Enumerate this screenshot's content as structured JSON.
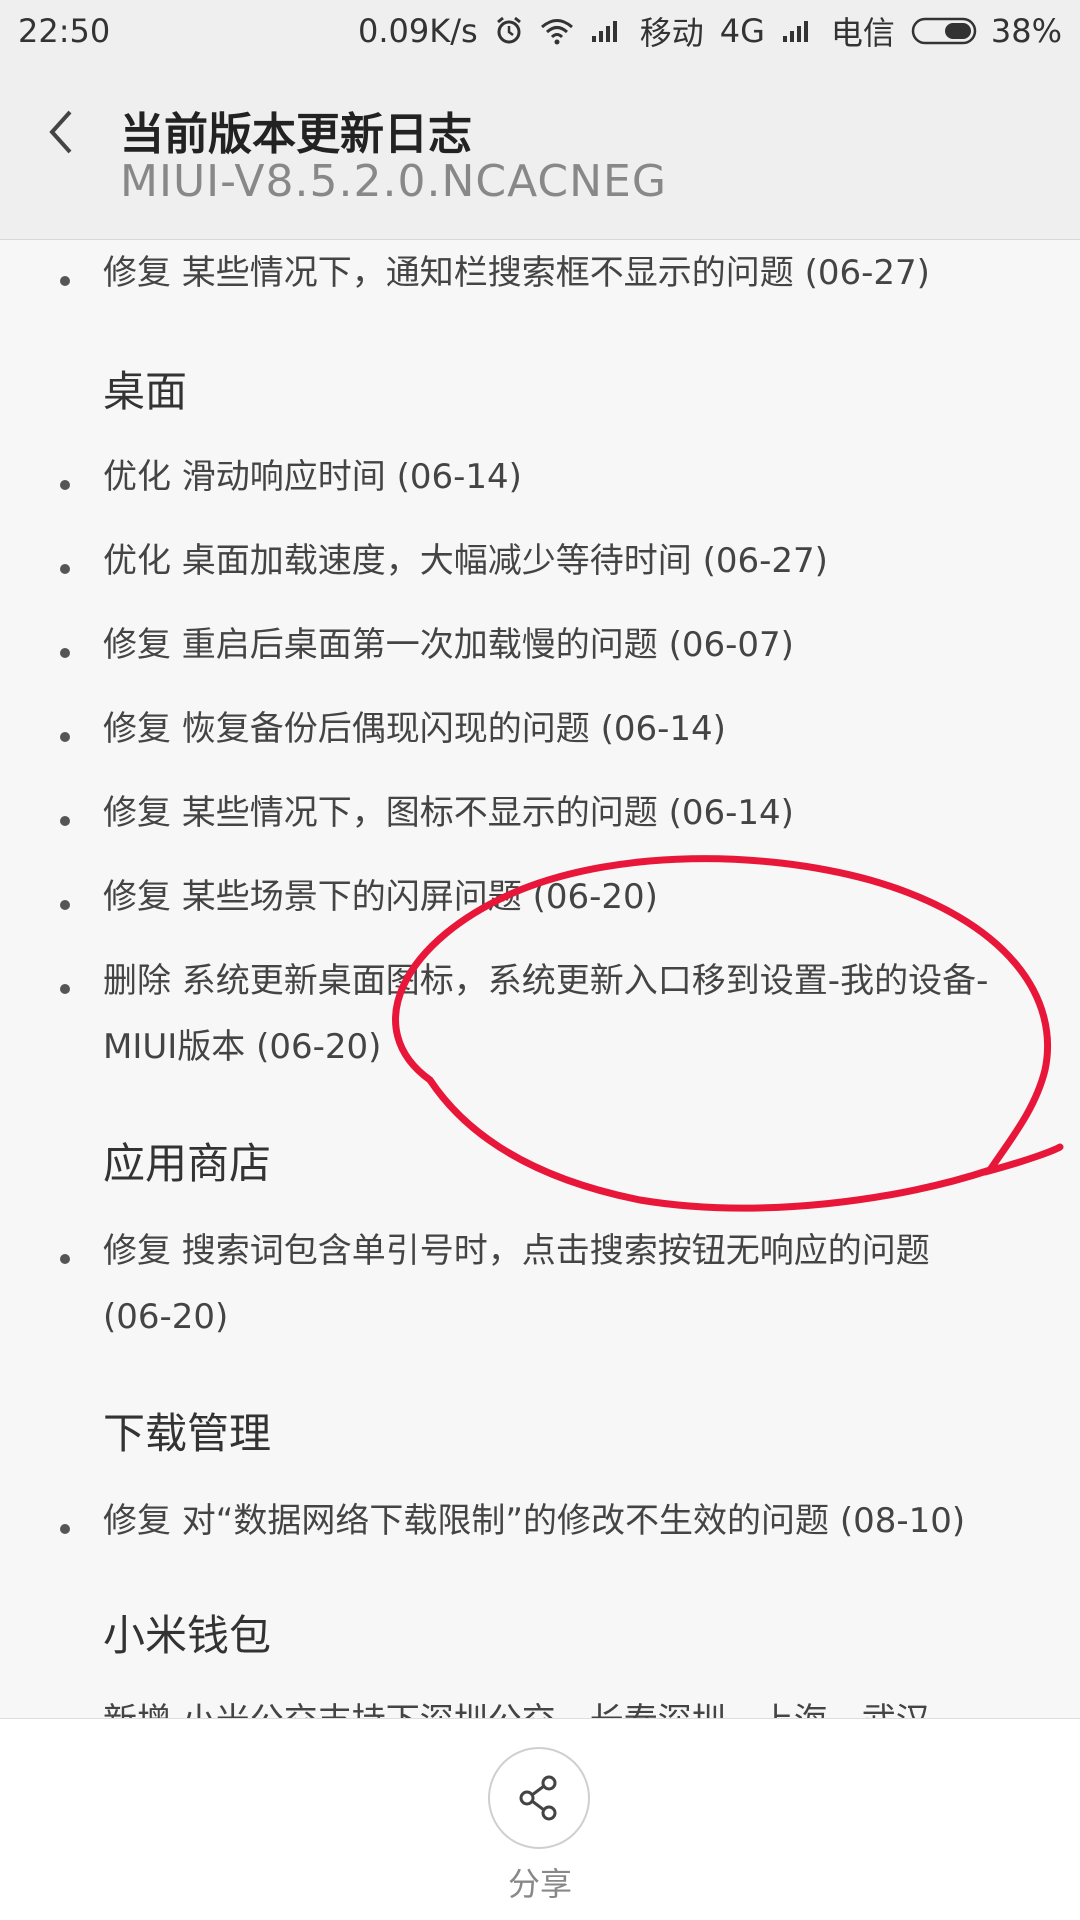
{
  "status_bar": {
    "time": "22:50",
    "net_speed": "0.09K/s",
    "carrier1": "移动",
    "network_type": "4G",
    "carrier2": "电信",
    "battery": "38%"
  },
  "header": {
    "title": "当前版本更新日志",
    "version": "MIUI-V8.5.2.0.NCACNEG"
  },
  "content": {
    "top_item": "修复 某些情况下，通知栏搜索框不显示的问题 (06-27)",
    "desktop": {
      "title": "桌面",
      "items": [
        "优化 滑动响应时间 (06-14)",
        "优化 桌面加载速度，大幅减少等待时间 (06-27)",
        "修复 重启后桌面第一次加载慢的问题 (06-07)",
        "修复 恢复备份后偶现闪现的问题 (06-14)",
        "修复 某些情况下，图标不显示的问题 (06-14)",
        "修复 某些场景下的闪屏问题 (06-20)",
        "删除 系统更新桌面图标，系统更新入口移到设置-我的设备-MIUI版本 (06-20)"
      ]
    },
    "app_store": {
      "title": "应用商店",
      "items": [
        "修复 搜索词包含单引号时，点击搜索按钮无响应的问题 (06-20)"
      ]
    },
    "download": {
      "title": "下载管理",
      "items": [
        "修复 对“数据网络下载限制”的修改不生效的问题 (08-10)"
      ]
    },
    "wallet": {
      "title": "小米钱包",
      "items": [
        "新增 小米公交支持下深圳公交，长春深圳，上海，武汉，苏州"
      ]
    }
  },
  "footer": {
    "share_label": "分享",
    "share_icon": "share-icon"
  },
  "colors": {
    "background": "#f7f7f7",
    "header_bg": "#efefef",
    "annotation": "#e8173a"
  }
}
